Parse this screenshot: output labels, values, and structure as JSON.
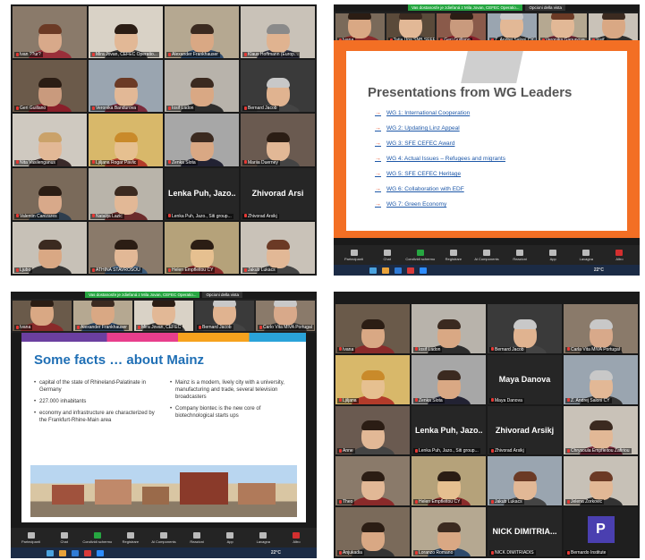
{
  "panel1": {
    "tiles": [
      {
        "name": "Ivan ??ur?",
        "bg": "#8a7a6a",
        "skin": "#d8a98a",
        "shirt": "#9a2f3a",
        "hair": "#6b3a25"
      },
      {
        "name": "Mira Jovan, CEFEC Operatio...",
        "bg": "#d9d2c6",
        "skin": "#e2b896",
        "shirt": "#3a3a3a",
        "hair": "#2b1d14"
      },
      {
        "name": "Alexander Frankhauser",
        "bg": "#b5a891",
        "skin": "#d9a884",
        "shirt": "#2e4a6b",
        "hair": "#3b2a20"
      },
      {
        "name": "Klaus Hoffmann (Europ...",
        "bg": "#c9c2b8",
        "skin": "#e0b390",
        "shirt": "#334",
        "hair": "#8a8a8a"
      },
      {
        "name": "Geri Guillano",
        "bg": "#6b5a4a",
        "skin": "#c99a7d",
        "shirt": "#8a1f2a",
        "hair": "#2b1d14"
      },
      {
        "name": "Veronika Bandurova",
        "bg": "#9aa5b0",
        "skin": "#e2b896",
        "shirt": "#7a2b3c",
        "hair": "#6b3a25"
      },
      {
        "name": "Iosif Ladon",
        "bg": "#b8b3ab",
        "skin": "#d9a884",
        "shirt": "#2d2d2d",
        "hair": "#3b2a20"
      },
      {
        "name": "Bernard Jacob",
        "bg": "#3a3a3a",
        "skin": "#e0b390",
        "shirt": "#444",
        "hair": "#c8c8c8"
      },
      {
        "name": "Nita Vasilenganus",
        "bg": "#cfc9c0",
        "skin": "#e2b896",
        "shirt": "#3a2a2a",
        "hair": "#caa26a"
      },
      {
        "name": "Ljiljana Rogar Pavlic",
        "bg": "#d8b86a",
        "skin": "#e6c090",
        "shirt": "#b23b2a",
        "hair": "#c98a2a"
      },
      {
        "name": "Zenka Slota",
        "bg": "#a7a7a7",
        "skin": "#d9a884",
        "shirt": "#223",
        "hair": "#3b2a20"
      },
      {
        "name": "Mariia Duerney",
        "bg": "#6a5a50",
        "skin": "#e2b896",
        "shirt": "#444",
        "hair": "#2b1d14"
      },
      {
        "name": "Valentin Canizares",
        "bg": "#7a6a5a",
        "skin": "#d8a98a",
        "shirt": "#2e3e4e",
        "hair": "#2b1d14"
      },
      {
        "name": "Natalija Lazic",
        "bg": "#b9b4aa",
        "skin": "#e2b896",
        "shirt": "#6b2b2b",
        "hair": "#3b2a20"
      },
      {
        "big": "Lenka Puh, Jazo...",
        "name": "Lenka Puh, Jazo., Siti group..."
      },
      {
        "big": "Zhivorad Arsi",
        "name": "Zhivorad Arsikj"
      },
      {
        "name": "Ljubo",
        "bg": "#c7c1b7",
        "skin": "#d9a884",
        "shirt": "#333",
        "hair": "#3b2a20"
      },
      {
        "name": "ATHINA STAVROSOU",
        "bg": "#8a7a6a",
        "skin": "#e2b896",
        "shirt": "#3a5a7a",
        "hair": "#2b1d14"
      },
      {
        "name": "Helen Empfleitou CY",
        "bg": "#b5a27a",
        "skin": "#e6c090",
        "shirt": "#8a2a2a",
        "hair": "#2b1d14",
        "active": true
      },
      {
        "name": "Jakub Lukacs",
        "bg": "#c9c2b8",
        "skin": "#e2b896",
        "shirt": "#444",
        "hair": "#6b3a25"
      }
    ]
  },
  "panel2": {
    "share_notice": "Vas dostanosťe je zdieľaná z Mila Jovan, CEFEC Operatio...",
    "options": "Opcioni della vista",
    "strip": [
      {
        "name": "Ivana",
        "bg": "#7a6a5a",
        "skin": "#d9a884",
        "shirt": "#8a2a2a",
        "hair": "#2b1d14"
      },
      {
        "name": "Tatia Una SNB SEFEN",
        "bg": "#5a4a3a",
        "skin": "#e2b896",
        "shirt": "#333",
        "hair": "#3b2a20"
      },
      {
        "name": "Geri Guillano",
        "bg": "#8a5a4a",
        "skin": "#c99a7d",
        "shirt": "#8a1f2a",
        "hair": "#2b1d14"
      },
      {
        "name": "Z. Andrej Saloni CY",
        "bg": "#9aa5b0",
        "skin": "#e2b896",
        "shirt": "#333",
        "hair": "#c8c8c8"
      },
      {
        "name": "Veronika Ganunova",
        "bg": "#b5a891",
        "skin": "#e2b896",
        "shirt": "#7a2b3c",
        "hair": "#6b3a25"
      },
      {
        "name": "Iosif",
        "bg": "#c9c2b8",
        "skin": "#d9a884",
        "shirt": "#2d2d2d",
        "hair": "#3b2a20"
      }
    ],
    "slide_title": "Presentations from WG Leaders",
    "items": [
      "WG 1: International Cooperation",
      "WG 2: Updating Linz Appeal",
      "WG 3: SFE CEFEC Award",
      "WG 4: Actual Issues – Refugees and migrants",
      "WG 5: SFE CEFEC Heritage",
      "WG 6: Collaboration with EDF",
      "WG 7: Green Economy"
    ]
  },
  "panel3": {
    "share_notice": "Vas dostanosťe je zdieľaná z Mila Jovan, CEFEC Operatio...",
    "options": "Opcioni della vista",
    "strip": [
      {
        "name": "Ivana",
        "bg": "#6a5a4a",
        "skin": "#d9a884",
        "shirt": "#8a2a2a",
        "hair": "#2b1d14"
      },
      {
        "name": "Alexander Frankhauser",
        "bg": "#b5a891",
        "skin": "#d9a884",
        "shirt": "#2e4a6b",
        "hair": "#3b2a20"
      },
      {
        "name": "Mira Jovan, CEFEC",
        "bg": "#d9d2c6",
        "skin": "#e2b896",
        "shirt": "#3a3a3a",
        "hair": "#2b1d14"
      },
      {
        "name": "Bernard Jacob",
        "bg": "#3a3a3a",
        "skin": "#e0b390",
        "shirt": "#444",
        "hair": "#c8c8c8"
      },
      {
        "name": "Carlo Vita MIVA Portugal",
        "bg": "#8a7a6a",
        "skin": "#d8a98a",
        "shirt": "#333",
        "hair": "#c8c8c8"
      }
    ],
    "slide_title": "Some facts … about Mainz",
    "left_bullets": [
      "capital of the state of Rhineland-Palatinate in Germany",
      "227.000 inhabitants",
      "economy and infrastructure are characterized by the Frankfurt-Rhine-Main area"
    ],
    "right_bullets": [
      "Mainz is a modern, lively city with a university, manufacturing and trade, several television broadcasters",
      "Company biontec is the new core of biotechnological starts ups"
    ]
  },
  "panel4": {
    "tiles": [
      {
        "name": "Ivana",
        "bg": "#6a5a4a",
        "skin": "#d9a884",
        "shirt": "#8a2a2a",
        "hair": "#2b1d14"
      },
      {
        "name": "Iosif Ladon",
        "bg": "#b8b3ab",
        "skin": "#d9a884",
        "shirt": "#2d2d2d",
        "hair": "#3b2a20"
      },
      {
        "name": "Bernard Jacob",
        "bg": "#3a3a3a",
        "skin": "#e0b390",
        "shirt": "#444",
        "hair": "#c8c8c8"
      },
      {
        "name": "Carla Vita MIVA Portugal",
        "bg": "#8a7a6a",
        "skin": "#d8a98a",
        "shirt": "#333",
        "hair": "#c8c8c8"
      },
      {
        "name": "Ljiljana",
        "bg": "#d8b86a",
        "skin": "#e6c090",
        "shirt": "#b23b2a",
        "hair": "#c98a2a"
      },
      {
        "name": "Zenka Slota",
        "bg": "#a7a7a7",
        "skin": "#d9a884",
        "shirt": "#223",
        "hair": "#3b2a20"
      },
      {
        "big": "Maya Danova",
        "name": "Maya Danova"
      },
      {
        "name": "Z. Andrej Saloni CY",
        "bg": "#9aa5b0",
        "skin": "#e2b896",
        "shirt": "#333",
        "hair": "#c8c8c8"
      },
      {
        "name": "Anne",
        "bg": "#6a5a50",
        "skin": "#e2b896",
        "shirt": "#444",
        "hair": "#2b1d14"
      },
      {
        "big": "Lenka Puh, Jazo...",
        "name": "Lenka Puh, Jazo., Siti group..."
      },
      {
        "big": "Zhivorad Arsikj",
        "name": "Zhivorad Arsikj"
      },
      {
        "name": "Chrysoula Empfleitou Zafiriou",
        "bg": "#c9c2b8",
        "skin": "#e2b896",
        "shirt": "#7a2b3c",
        "hair": "#3b2a20"
      },
      {
        "name": "Theo",
        "bg": "#8a7a6a",
        "skin": "#e2b896",
        "shirt": "#8a2a2a",
        "hair": "#2b1d14"
      },
      {
        "name": "Helen Empfleitou CY",
        "bg": "#b5a27a",
        "skin": "#e6c090",
        "shirt": "#8a2a2a",
        "hair": "#2b1d14"
      },
      {
        "name": "Jakub Lukacs",
        "bg": "#9aa5b0",
        "skin": "#e2b896",
        "shirt": "#444",
        "hair": "#6b3a25"
      },
      {
        "name": "Jelena Zorkovic",
        "bg": "#c7c1b7",
        "skin": "#e2b896",
        "shirt": "#333",
        "hair": "#6b3a25",
        "active": true
      },
      {
        "name": "Anjukadia",
        "bg": "#7a6a5a",
        "skin": "#d9a884",
        "shirt": "#333",
        "hair": "#2b1d14"
      },
      {
        "name": "Loranzo Romano",
        "bg": "#b5a891",
        "skin": "#d9a884",
        "shirt": "#2e4a6b",
        "hair": "#3b2a20"
      },
      {
        "big": "NICK DIMITRIA...",
        "name": "NICK DIMITRIADIS"
      },
      {
        "avatar": "P",
        "name": "Bernardo Institute"
      }
    ]
  },
  "toolbar": [
    {
      "label": "Partecipanti",
      "cls": ""
    },
    {
      "label": "Chat",
      "cls": ""
    },
    {
      "label": "Condividi schermo",
      "cls": "share"
    },
    {
      "label": "Registrare",
      "cls": ""
    },
    {
      "label": "Ai Components",
      "cls": ""
    },
    {
      "label": "Reazioni",
      "cls": ""
    },
    {
      "label": "App",
      "cls": ""
    },
    {
      "label": "Lavagna",
      "cls": ""
    },
    {
      "label": "Altro",
      "cls": "end"
    }
  ],
  "tray": "22°C",
  "colors": {
    "zoom_green": "#26a641",
    "slide_orange": "#f36f24",
    "title_blue": "#1f6fb5",
    "link_blue": "#1e58a8"
  }
}
